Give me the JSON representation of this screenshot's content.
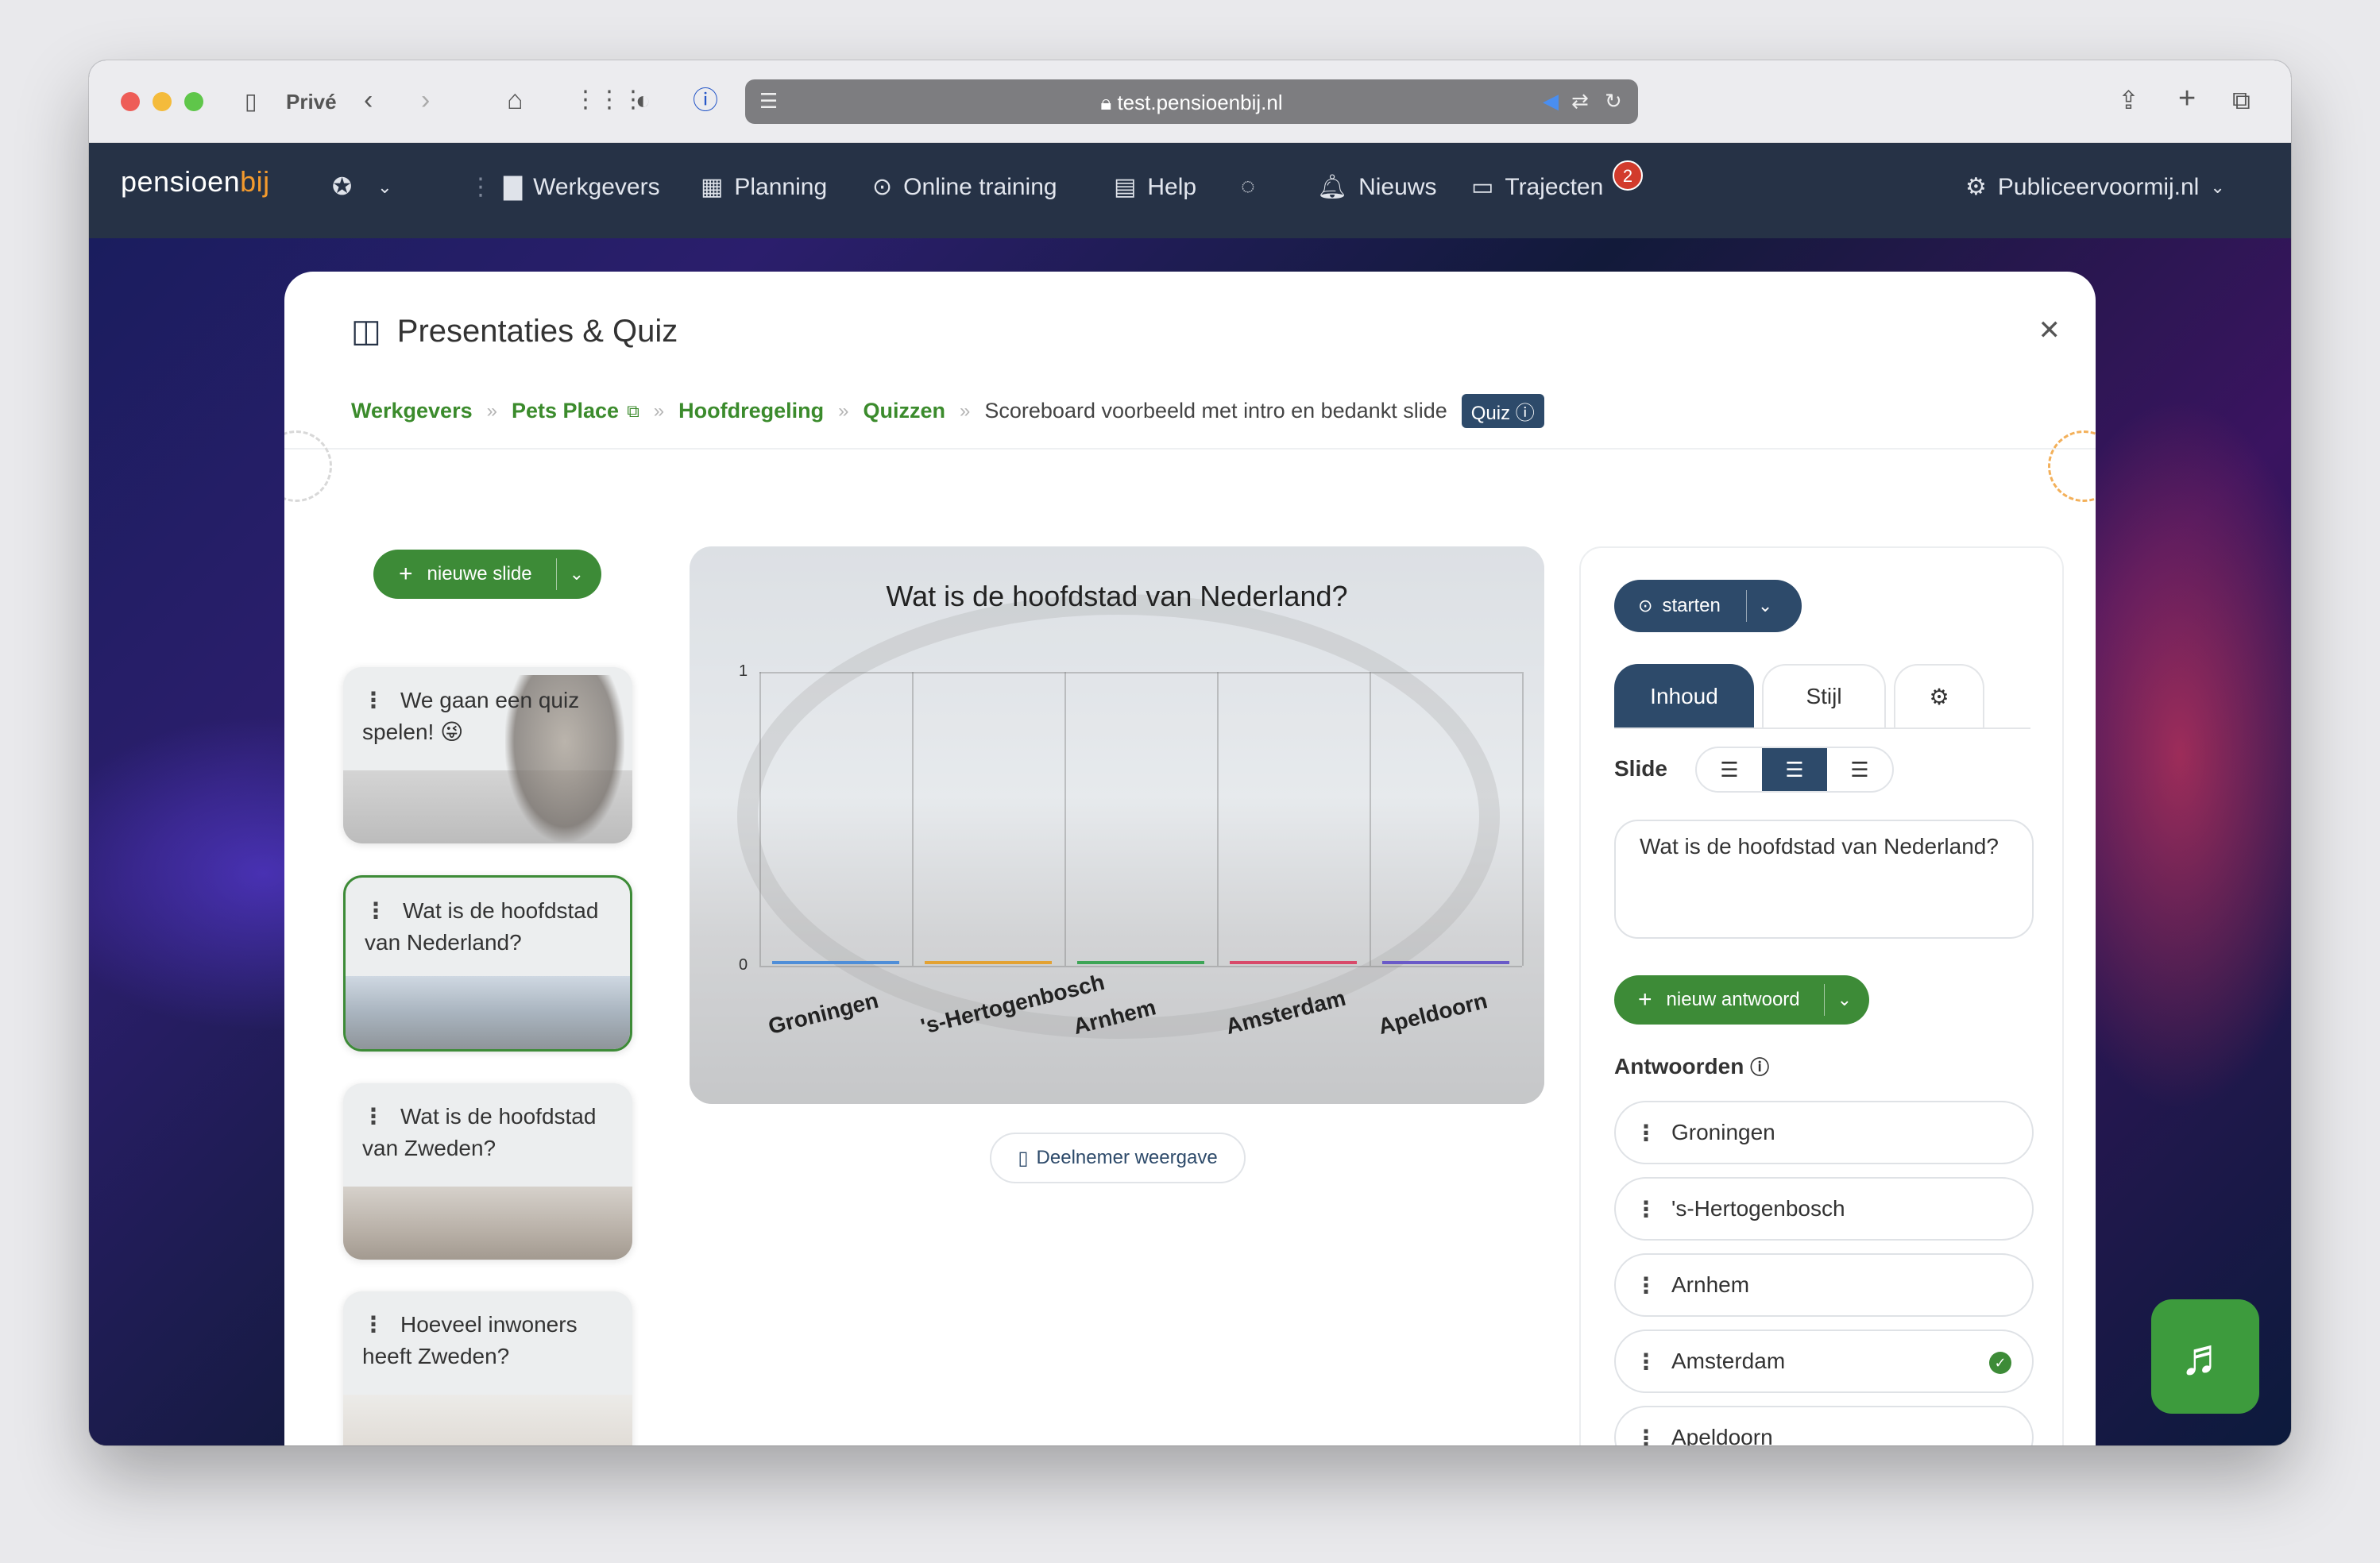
{
  "browser": {
    "profile": "Privé",
    "url": "test.pensioenbij.nl"
  },
  "nav": {
    "logo_main": "pensioen",
    "logo_accent": "bij",
    "items": [
      {
        "label": "Werkgevers",
        "icon": "briefcase-icon"
      },
      {
        "label": "Planning",
        "icon": "calendar-icon"
      },
      {
        "label": "Online training",
        "icon": "play-circle-icon"
      },
      {
        "label": "Help",
        "icon": "book-icon"
      },
      {
        "label": "",
        "icon": "chat-icon"
      },
      {
        "label": "Nieuws",
        "icon": "bell-icon"
      },
      {
        "label": "Trajecten",
        "icon": "window-icon",
        "badge": "2"
      }
    ],
    "account": "Publiceervoormij.nl"
  },
  "panel": {
    "title": "Presentaties & Quiz",
    "breadcrumb": [
      "Werkgevers",
      "Pets Place",
      "Hoofdregeling",
      "Quizzen"
    ],
    "breadcrumb_current": "Scoreboard voorbeeld met intro en bedankt slide",
    "tag": "Quiz"
  },
  "slides": {
    "new_label": "nieuwe slide",
    "items": [
      {
        "text": "We gaan een quiz spelen! 😜"
      },
      {
        "text": "Wat is de hoofdstad van Nederland?"
      },
      {
        "text": "Wat is de hoofdstad van Zweden?"
      },
      {
        "text": "Hoeveel inwoners heeft Zweden?"
      }
    ]
  },
  "preview": {
    "question": "Wat is de hoofdstad van Nederland?",
    "participant_view": "Deelnemer weergave"
  },
  "chart_data": {
    "type": "bar",
    "title": "Wat is de hoofdstad van Nederland?",
    "categories": [
      "Groningen",
      "'s-Hertogenbosch",
      "Arnhem",
      "Amsterdam",
      "Apeldoorn"
    ],
    "values": [
      0,
      0,
      0,
      0,
      0
    ],
    "colors": [
      "#4f8ed8",
      "#e3a233",
      "#3da556",
      "#d84a6a",
      "#6a5ac8"
    ],
    "ylim": [
      0,
      1
    ],
    "yticks": [
      "0",
      "1"
    ]
  },
  "editor": {
    "start_label": "starten",
    "tabs": [
      "Inhoud",
      "Stijl",
      ""
    ],
    "slide_label": "Slide",
    "slide_text": "Wat is de hoofdstad van Nederland?",
    "new_answer_label": "nieuw antwoord",
    "answers_label": "Antwoorden",
    "answers": [
      {
        "text": "Groningen",
        "correct": false
      },
      {
        "text": "'s-Hertogenbosch",
        "correct": false
      },
      {
        "text": "Arnhem",
        "correct": false
      },
      {
        "text": "Amsterdam",
        "correct": true
      },
      {
        "text": "Apeldoorn",
        "correct": false
      }
    ]
  }
}
